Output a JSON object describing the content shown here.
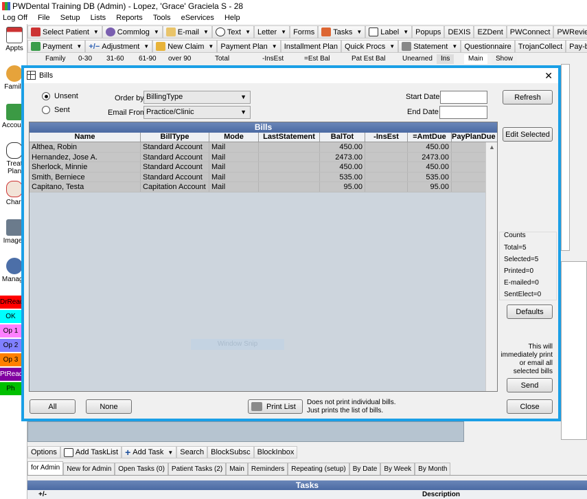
{
  "window": {
    "title": "PWDental Training DB (Admin) - Lopez, 'Grace' Graciela S - 28"
  },
  "menu": [
    "Log Off",
    "File",
    "Setup",
    "Lists",
    "Reports",
    "Tools",
    "eServices",
    "Help"
  ],
  "toolbar1": [
    {
      "label": "Select Patient",
      "dd": true
    },
    {
      "label": "Commlog",
      "dd": true
    },
    {
      "label": "E-mail",
      "dd": true
    },
    {
      "label": "Text",
      "dd": true
    },
    {
      "label": "Letter",
      "dd": true
    },
    {
      "label": "Forms",
      "dd": false
    },
    {
      "label": "Tasks",
      "dd": true
    },
    {
      "label": "Label",
      "dd": true
    },
    {
      "label": "Popups",
      "dd": false
    },
    {
      "label": "DEXIS",
      "dd": false
    },
    {
      "label": "EZDent",
      "dd": false
    },
    {
      "label": "PWConnect",
      "dd": false
    },
    {
      "label": "PWReviews",
      "dd": false
    }
  ],
  "toolbar2": [
    {
      "label": "Payment",
      "dd": true
    },
    {
      "label": "Adjustment",
      "dd": true
    },
    {
      "label": "New Claim",
      "dd": true
    },
    {
      "label": "Payment Plan",
      "dd": true
    },
    {
      "label": "Installment Plan",
      "dd": false
    },
    {
      "label": "Quick Procs",
      "dd": true
    },
    {
      "label": "Statement",
      "dd": true
    },
    {
      "label": "Questionnaire",
      "dd": false
    },
    {
      "label": "TrojanCollect",
      "dd": false
    },
    {
      "label": "Pay-by-Text",
      "dd": false
    }
  ],
  "aging": [
    "Family",
    "0-30",
    "31-60",
    "61-90",
    "over 90",
    "Total",
    "-InsEst",
    "=Est Bal",
    "Pat Est Bal",
    "Unearned",
    "Ins",
    "Main",
    "Show"
  ],
  "modules": [
    "Appts",
    "Family",
    "Account",
    "Treat Plan",
    "Chart",
    "Images",
    "Manage"
  ],
  "status_items": [
    {
      "label": "DrReady",
      "color": "#ff0000",
      "text": "#000000"
    },
    {
      "label": "OK",
      "color": "#00ffff",
      "text": "#000000"
    },
    {
      "label": "Op 1",
      "color": "#ff80ff",
      "text": "#000000"
    },
    {
      "label": "Op 2",
      "color": "#8080ff",
      "text": "#000000"
    },
    {
      "label": "Op 3",
      "color": "#ff8000",
      "text": "#000000"
    },
    {
      "label": "PtReady",
      "color": "#8000a0",
      "text": "#ffffff"
    },
    {
      "label": "Ph Asst",
      "color": "#00c000",
      "text": "#000000"
    }
  ],
  "dialog": {
    "title": "Bills",
    "radio_unsent": "Unsent",
    "radio_sent": "Sent",
    "order_by_label": "Order by",
    "order_by_value": "BillingType",
    "email_from_label": "Email From",
    "email_from_value": "Practice/Clinic",
    "start_date_label": "Start Date",
    "end_date_label": "End Date",
    "refresh": "Refresh",
    "edit_selected": "Edit Selected",
    "grid_title": "Bills",
    "columns": [
      "Name",
      "BillType",
      "Mode",
      "LastStatement",
      "BalTot",
      "-InsEst",
      "=AmtDue",
      "PayPlanDue"
    ],
    "rows": [
      [
        "Althea, Robin",
        "Standard Account",
        "Mail",
        "",
        "450.00",
        "",
        "450.00",
        ""
      ],
      [
        "Hernandez, Jose A.",
        "Standard Account",
        "Mail",
        "",
        "2473.00",
        "",
        "2473.00",
        ""
      ],
      [
        "Sherlock, Minnie",
        "Standard Account",
        "Mail",
        "",
        "450.00",
        "",
        "450.00",
        ""
      ],
      [
        "Smith, Berniece",
        "Standard Account",
        "Mail",
        "",
        "535.00",
        "",
        "535.00",
        ""
      ],
      [
        "Capitano, Testa",
        "Capitation Account",
        "Mail",
        "",
        "95.00",
        "",
        "95.00",
        ""
      ]
    ],
    "watermark": "Window Snip",
    "counts_title": "Counts",
    "counts": [
      "Total=5",
      "Selected=5",
      "Printed=0",
      "E-mailed=0",
      "SentElect=0"
    ],
    "defaults": "Defaults",
    "send_note": [
      "This will",
      "immediately print",
      "or email all",
      "selected bills"
    ],
    "send": "Send",
    "close": "Close",
    "all": "All",
    "none": "None",
    "print_list": "Print List",
    "print_note": [
      "Does not print individual bills.",
      "Just prints the list of bills."
    ]
  },
  "bottom_toolbar": [
    {
      "label": "Options"
    },
    {
      "label": "Add TaskList"
    },
    {
      "label": "Add Task",
      "dd": true
    },
    {
      "label": "Search"
    },
    {
      "label": "BlockSubsc"
    },
    {
      "label": "BlockInbox"
    }
  ],
  "task_tabs": [
    "for Admin",
    "New for Admin",
    "Open Tasks (0)",
    "Patient Tasks (2)",
    "Main",
    "Reminders",
    "Repeating (setup)",
    "By Date",
    "By Week",
    "By Month"
  ],
  "tasks": {
    "title": "Tasks",
    "col_plusminus": "+/-",
    "col_description": "Description"
  }
}
